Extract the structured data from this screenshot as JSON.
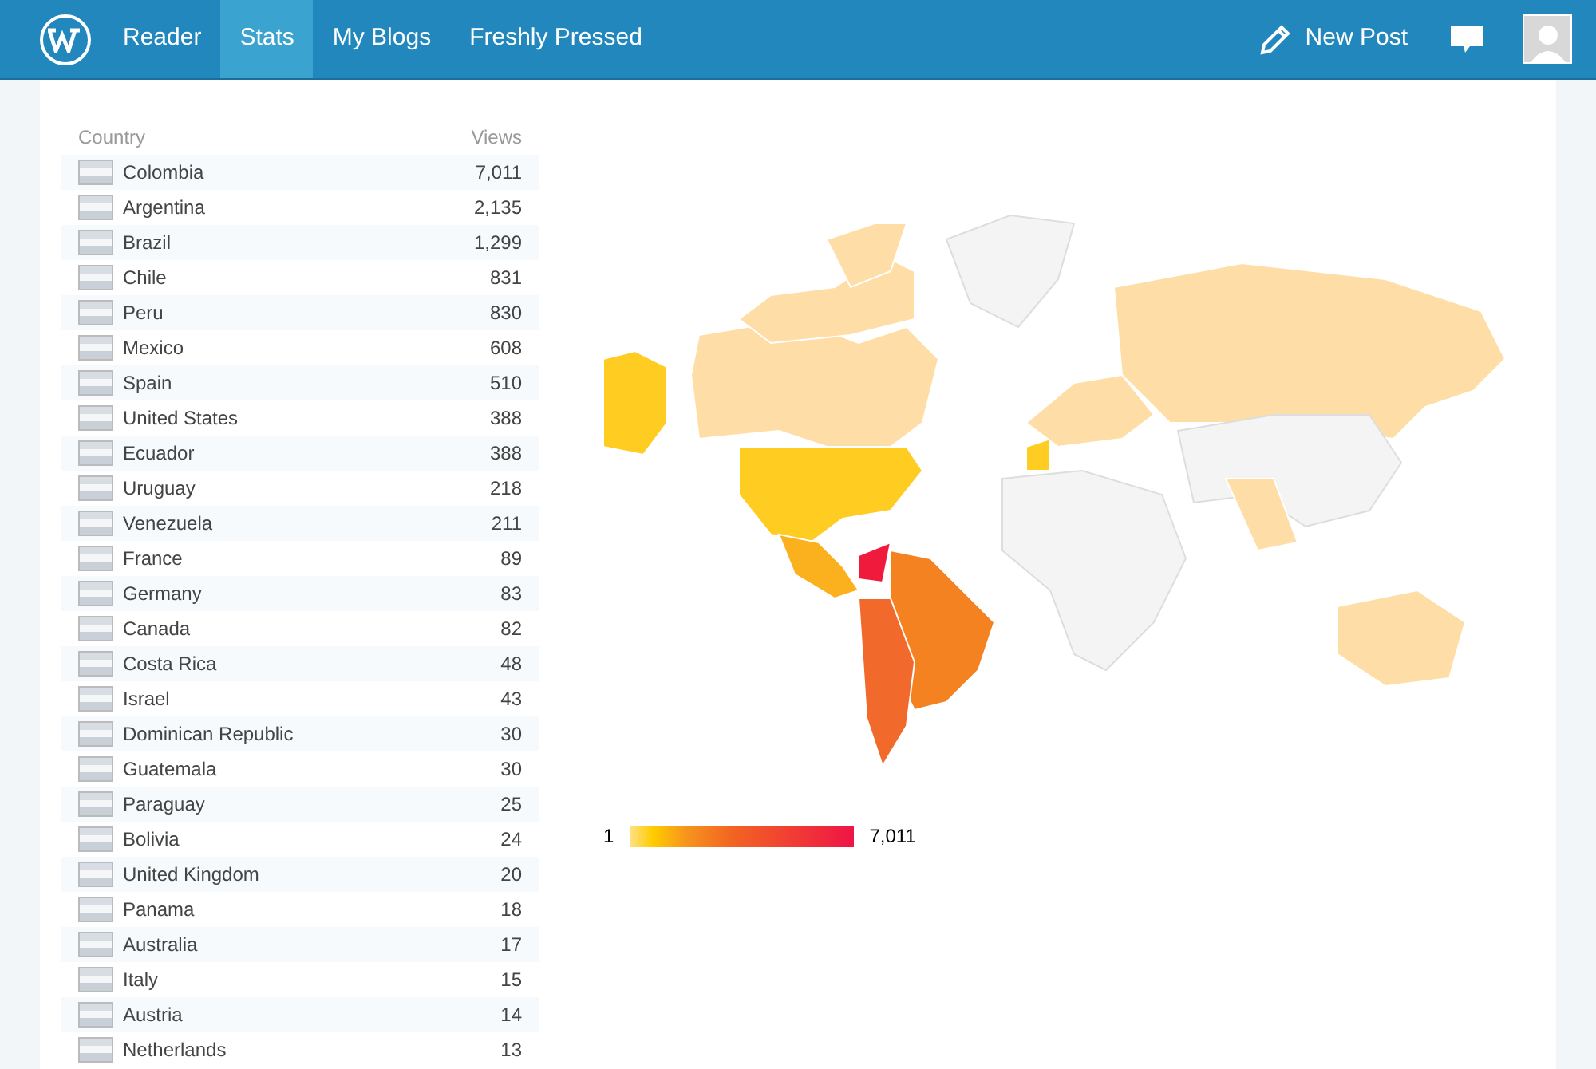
{
  "nav": {
    "items": [
      {
        "label": "Reader",
        "selected": false
      },
      {
        "label": "Stats",
        "selected": true
      },
      {
        "label": "My Blogs",
        "selected": false
      },
      {
        "label": "Freshly Pressed",
        "selected": false
      }
    ],
    "new_post": "New Post"
  },
  "table": {
    "columns": [
      "Country",
      "Views"
    ],
    "rows": [
      {
        "country": "Colombia",
        "views": "7,011"
      },
      {
        "country": "Argentina",
        "views": "2,135"
      },
      {
        "country": "Brazil",
        "views": "1,299"
      },
      {
        "country": "Chile",
        "views": "831"
      },
      {
        "country": "Peru",
        "views": "830"
      },
      {
        "country": "Mexico",
        "views": "608"
      },
      {
        "country": "Spain",
        "views": "510"
      },
      {
        "country": "United States",
        "views": "388"
      },
      {
        "country": "Ecuador",
        "views": "388"
      },
      {
        "country": "Uruguay",
        "views": "218"
      },
      {
        "country": "Venezuela",
        "views": "211"
      },
      {
        "country": "France",
        "views": "89"
      },
      {
        "country": "Germany",
        "views": "83"
      },
      {
        "country": "Canada",
        "views": "82"
      },
      {
        "country": "Costa Rica",
        "views": "48"
      },
      {
        "country": "Israel",
        "views": "43"
      },
      {
        "country": "Dominican Republic",
        "views": "30"
      },
      {
        "country": "Guatemala",
        "views": "30"
      },
      {
        "country": "Paraguay",
        "views": "25"
      },
      {
        "country": "Bolivia",
        "views": "24"
      },
      {
        "country": "United Kingdom",
        "views": "20"
      },
      {
        "country": "Panama",
        "views": "18"
      },
      {
        "country": "Australia",
        "views": "17"
      },
      {
        "country": "Italy",
        "views": "15"
      },
      {
        "country": "Austria",
        "views": "14"
      },
      {
        "country": "Netherlands",
        "views": "13"
      }
    ]
  },
  "legend": {
    "min": "1",
    "max": "7,011"
  }
}
